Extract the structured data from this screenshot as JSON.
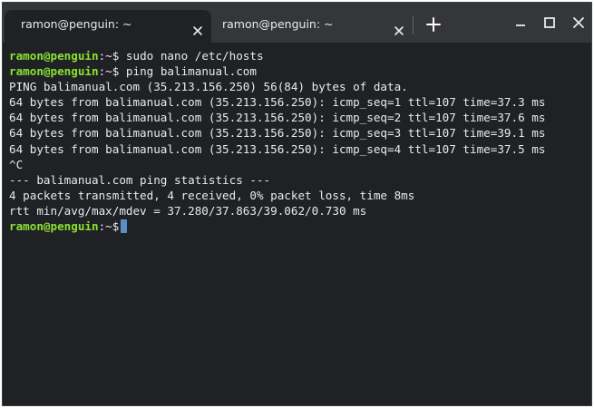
{
  "tabs": [
    {
      "title": "ramon@penguin: ~",
      "active": true
    },
    {
      "title": "ramon@penguin: ~",
      "active": false
    }
  ],
  "window_controls": {
    "new_tab": "plus-icon",
    "minimize": "minimize-icon",
    "maximize": "maximize-icon",
    "close": "close-icon"
  },
  "colors": {
    "terminal_bg": "#202124",
    "titlebar_bg": "#35363a",
    "prompt_user": "#8ae234",
    "text": "#e8eaed",
    "cursor": "#5a8ec4"
  },
  "terminal": {
    "prompt_user": "ramon@penguin",
    "prompt_path": ":~$",
    "commands": [
      " sudo nano /etc/hosts",
      " ping balimanual.com"
    ],
    "output": [
      "PING balimanual.com (35.213.156.250) 56(84) bytes of data.",
      "64 bytes from balimanual.com (35.213.156.250): icmp_seq=1 ttl=107 time=37.3 ms",
      "64 bytes from balimanual.com (35.213.156.250): icmp_seq=2 ttl=107 time=37.6 ms",
      "64 bytes from balimanual.com (35.213.156.250): icmp_seq=3 ttl=107 time=39.1 ms",
      "64 bytes from balimanual.com (35.213.156.250): icmp_seq=4 ttl=107 time=37.5 ms",
      "^C",
      "--- balimanual.com ping statistics ---",
      "4 packets transmitted, 4 received, 0% packet loss, time 8ms",
      "rtt min/avg/max/mdev = 37.280/37.863/39.062/0.730 ms"
    ]
  }
}
